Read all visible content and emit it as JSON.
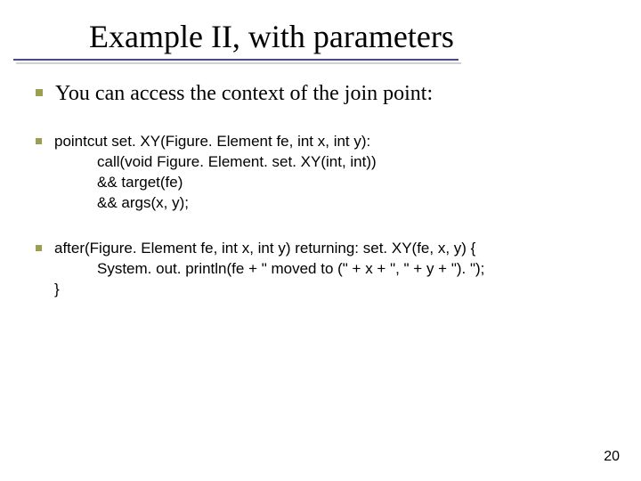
{
  "title": "Example II, with parameters",
  "bullets": {
    "b1": "You can access the context of the join point:",
    "b2": {
      "l1": "pointcut set. XY(Figure. Element fe, int x, int y):",
      "l2": "call(void Figure. Element. set. XY(int, int))",
      "l3": "&& target(fe)",
      "l4": "&& args(x, y);"
    },
    "b3": {
      "l1": "after(Figure. Element fe, int x, int y) returning: set. XY(fe, x, y) {",
      "l2": "System. out. println(fe + \" moved to (\" + x + \", \" + y + \"). \");",
      "l3": "}"
    }
  },
  "page_number": "20"
}
